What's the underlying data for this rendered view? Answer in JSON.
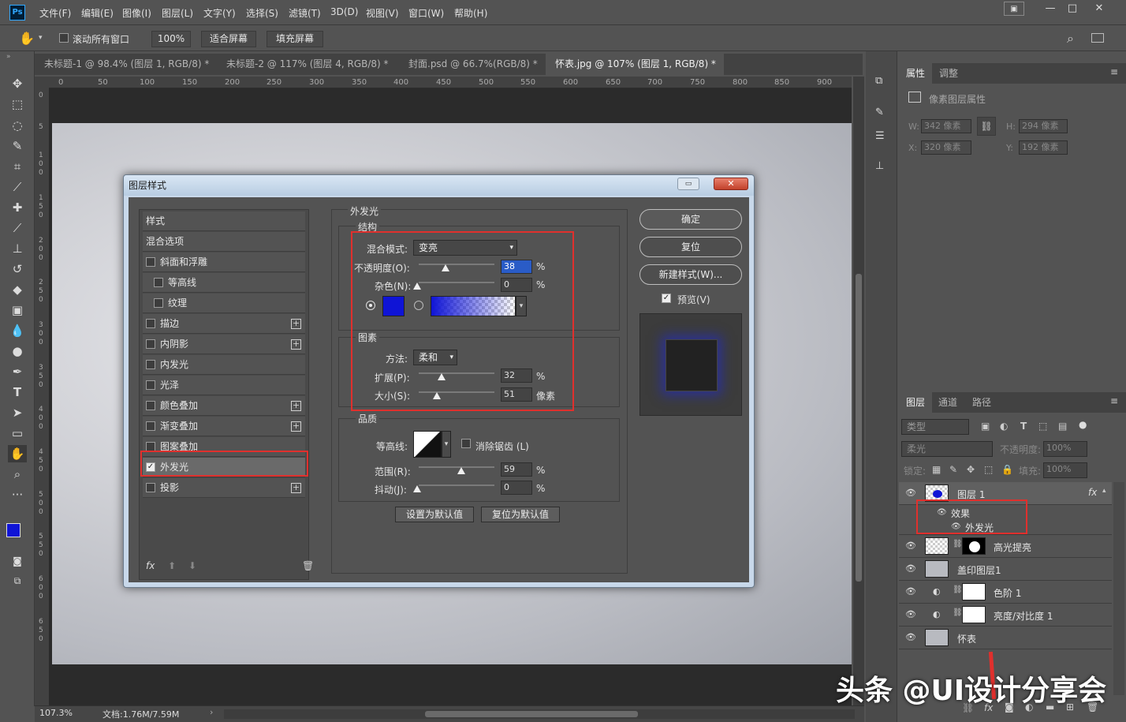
{
  "app": {
    "logo": "Ps",
    "menus": [
      "文件(F)",
      "编辑(E)",
      "图像(I)",
      "图层(L)",
      "文字(Y)",
      "选择(S)",
      "滤镜(T)",
      "3D(D)",
      "视图(V)",
      "窗口(W)",
      "帮助(H)"
    ]
  },
  "options": {
    "scroll_all": "滚动所有窗口",
    "zoom": "100%",
    "fit_screen": "适合屏幕",
    "fill_screen": "填充屏幕"
  },
  "tabs": [
    "未标题-1 @ 98.4% (图层 1, RGB/8) *",
    "未标题-2 @ 117% (图层 4, RGB/8) *",
    "封面.psd @ 66.7%(RGB/8) *",
    "怀表.jpg @ 107% (图层 1, RGB/8) *"
  ],
  "ruler": [
    "0",
    "50",
    "100",
    "150",
    "200",
    "250",
    "300",
    "350",
    "400",
    "450",
    "500",
    "550",
    "600",
    "650",
    "700",
    "750",
    "800",
    "850",
    "900"
  ],
  "vruler": [
    "0",
    "5",
    "1 0 0",
    "1 5 0",
    "2 0 0",
    "2 5 0",
    "3 0 0",
    "3 5 0",
    "4 0 0",
    "4 5 0",
    "5 0 0",
    "5 5 0",
    "6 0 0",
    "6 5 0"
  ],
  "status": {
    "zoom": "107.3%",
    "doc": "文档:1.76M/7.59M"
  },
  "dialog": {
    "title": "图层样式",
    "styles": [
      "样式",
      "混合选项",
      "斜面和浮雕",
      "等高线",
      "纹理",
      "描边",
      "内阴影",
      "内发光",
      "光泽",
      "颜色叠加",
      "渐变叠加",
      "图案叠加",
      "外发光",
      "投影"
    ],
    "section_title": "外发光",
    "structure": "结构",
    "blend_mode_label": "混合模式:",
    "blend_mode": "变亮",
    "opacity_label": "不透明度(O):",
    "opacity": "38",
    "noise_label": "杂色(N):",
    "noise": "0",
    "percent": "%",
    "glow_color": "#0f14d6",
    "elements": "图素",
    "method_label": "方法:",
    "method": "柔和",
    "spread_label": "扩展(P):",
    "spread": "32",
    "size_label": "大小(S):",
    "size": "51",
    "px_unit": "像素",
    "quality": "品质",
    "contour_label": "等高线:",
    "antialias": "消除锯齿 (L)",
    "range_label": "范围(R):",
    "range": "59",
    "jitter_label": "抖动(J):",
    "jitter": "0",
    "set_default": "设置为默认值",
    "reset_default": "复位为默认值",
    "ok": "确定",
    "reset": "复位",
    "new_style": "新建样式(W)...",
    "preview": "预览(V)",
    "fx": "fx"
  },
  "properties": {
    "tab1": "属性",
    "tab2": "调整",
    "title": "像素图层属性",
    "w_label": "W:",
    "w": "342 像素",
    "h_label": "H:",
    "h": "294 像素",
    "x_label": "X:",
    "x": "320 像素",
    "y_label": "Y:",
    "y": "192 像素"
  },
  "layers_panel": {
    "tabs": [
      "图层",
      "通道",
      "路径"
    ],
    "filter": "类型",
    "blend": "柔光",
    "opacity_label": "不透明度:",
    "opacity": "100%",
    "lock_label": "锁定:",
    "fill_label": "填充:",
    "fill": "100%",
    "layers": [
      "图层 1",
      "效果",
      "外发光",
      "高光提亮",
      "盖印图层1",
      "色阶 1",
      "亮度/对比度 1",
      "怀表"
    ],
    "fx": "fx"
  },
  "watermark": "头条 @UI设计分享会"
}
